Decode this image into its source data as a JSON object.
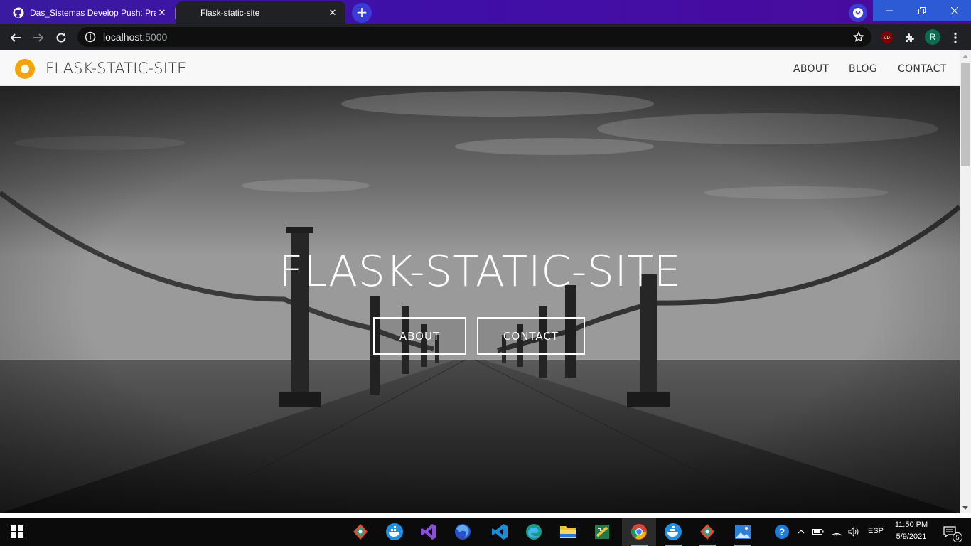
{
  "browser": {
    "tabs": [
      {
        "title": "Das_Sistemas Develop Push: Practica",
        "favicon": "github-icon",
        "active": false
      },
      {
        "title": "Flask-static-site",
        "favicon": "",
        "active": true
      }
    ],
    "address": {
      "host": "localhost",
      "port": ":5000"
    },
    "profile_initial": "R",
    "colors": {
      "tabstrip": "#3f0fa8",
      "toolbar": "#202124",
      "omnibox": "#0f0f0f"
    }
  },
  "site": {
    "brand": "FLASK-STATIC-SITE",
    "nav": [
      "ABOUT",
      "BLOG",
      "CONTACT"
    ],
    "hero": {
      "title": "FLASK-STATIC-SITE",
      "buttons": [
        "ABOUT",
        "CONTACT"
      ],
      "background": "grayscale pier at sea"
    },
    "colors": {
      "logo": "#f5a30b",
      "nav_bg": "#f8f8f8"
    }
  },
  "taskbar": {
    "apps": [
      "gitkraken-icon",
      "docker-icon",
      "visual-studio-icon",
      "firefox-icon",
      "vscode-icon",
      "edge-icon",
      "file-explorer-icon",
      "sublime-merge-icon",
      "chrome-icon",
      "docker-icon",
      "gitkraken-icon",
      "photos-icon"
    ],
    "language": "ESP",
    "time": "11:50 PM",
    "date": "5/9/2021",
    "notifications": "5"
  }
}
